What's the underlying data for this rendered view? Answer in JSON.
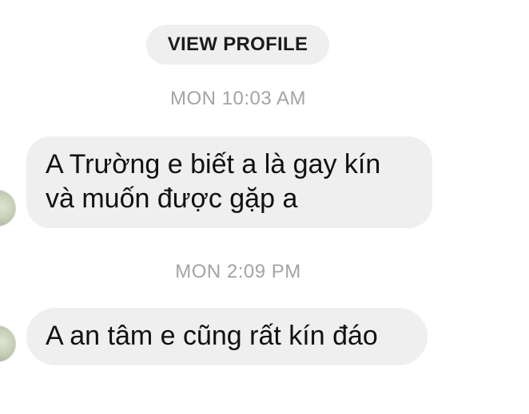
{
  "header": {
    "view_profile_label": "VIEW PROFILE"
  },
  "messages": [
    {
      "timestamp": "MON 10:03 AM",
      "text": "A Trường e biết a là gay kín\nvà muốn được gặp a"
    },
    {
      "timestamp": "MON 2:09 PM",
      "text": "A an tâm e cũng rất kín đáo"
    }
  ],
  "colors": {
    "bubble_background": "#efefef",
    "timestamp_text": "#a4a4a4",
    "message_text": "#111111",
    "page_background": "#ffffff"
  }
}
